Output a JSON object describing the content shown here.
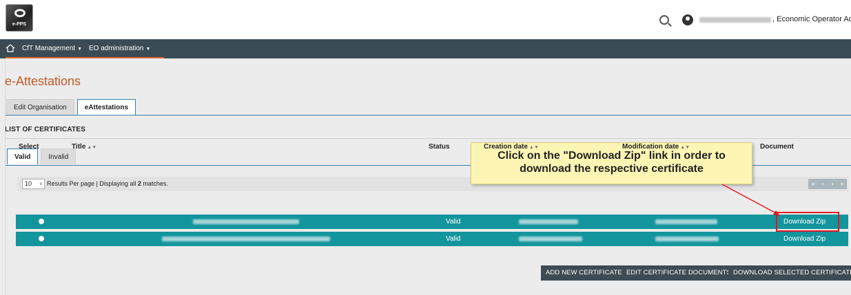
{
  "header": {
    "logo_text": "e-PPS",
    "user_role": ", Economic Operator Admin",
    "icons": [
      "search-icon",
      "user-icon"
    ]
  },
  "nav": {
    "home_icon": "home-icon",
    "items": [
      {
        "label": "CfT Management"
      },
      {
        "label": "EO administration"
      }
    ]
  },
  "page": {
    "title": "e-Attestations",
    "tabs": [
      {
        "label": "Edit Organisation",
        "active": false
      },
      {
        "label": "eAttestations",
        "active": true
      }
    ],
    "section_title": "LIST OF CERTIFICATES",
    "sub_tabs": [
      {
        "label": "Valid",
        "active": true
      },
      {
        "label": "Invalid",
        "active": false
      }
    ]
  },
  "results": {
    "per_page": "10",
    "text_prefix": "Results Per page | Displaying all ",
    "count": "2",
    "text_suffix": " matches.",
    "pager": [
      "«",
      "‹",
      "›",
      "»"
    ]
  },
  "table": {
    "columns": [
      "Select",
      "Title",
      "Status",
      "Creation date",
      "Modification date",
      "Document"
    ],
    "rows": [
      {
        "status": "Valid",
        "document": "Download Zip"
      },
      {
        "status": "Valid",
        "document": "Download Zip"
      }
    ]
  },
  "callout": {
    "line1": "Click on the \"Download Zip\" link in order to",
    "line2": "download the respective certificate"
  },
  "buttons": {
    "add": "ADD NEW CERTIFICATE",
    "edit": "EDIT CERTIFICATE DOCUMENTS",
    "download": "DOWNLOAD SELECTED CERTIFICATES"
  },
  "colors": {
    "accent": "#13959d",
    "nav_bg": "#3b4b55",
    "title": "#c05a2a",
    "highlight": "#e0171e"
  }
}
